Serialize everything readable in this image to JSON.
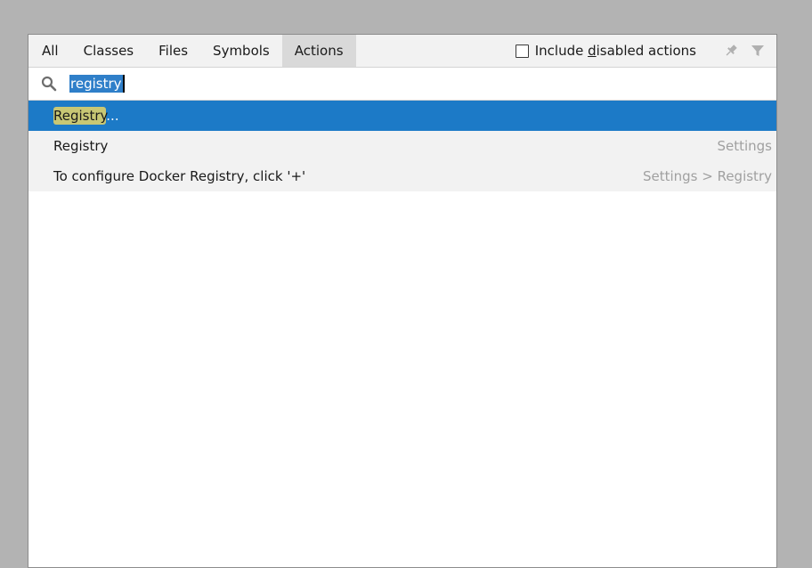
{
  "tabs": [
    {
      "label": "All"
    },
    {
      "label": "Classes"
    },
    {
      "label": "Files"
    },
    {
      "label": "Symbols"
    },
    {
      "label": "Actions",
      "selected": true
    }
  ],
  "include_disabled": {
    "label_before": "Include ",
    "mnemonic": "d",
    "label_after": "isabled actions",
    "checked": false
  },
  "header_icons": [
    "pin-icon",
    "filter-icon"
  ],
  "search": {
    "value": "registry"
  },
  "results": [
    {
      "highlight": "Registry",
      "rest": "...",
      "location": "",
      "selected": true
    },
    {
      "label": "Registry",
      "location": "Settings"
    },
    {
      "label": "To configure Docker Registry, click '+'",
      "location": "Settings > Registry"
    }
  ],
  "colors": {
    "selection": "#1c7ac7",
    "match_highlight": "#c8c774",
    "tab_selected": "#d9d9d9"
  }
}
